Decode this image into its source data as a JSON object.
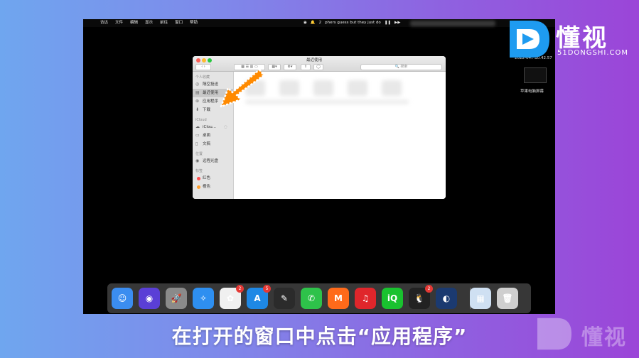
{
  "menubar": {
    "apple": "",
    "menus": [
      "访达",
      "文件",
      "编辑",
      "显示",
      "前往",
      "窗口",
      "帮助"
    ],
    "status_text": "phers guess but they just do",
    "badge_count": "2"
  },
  "desktop": {
    "date_label": "2022-04...10.42.57",
    "thumb_label": "苹果电脑屏幕"
  },
  "finder": {
    "title": "最近使用",
    "search_placeholder": "搜索",
    "sidebar": {
      "sections": {
        "personal": "个人收藏",
        "icloud": "iCloud",
        "locations": "位置",
        "tags": "标签"
      },
      "items": [
        {
          "label": "隔空投送",
          "icon": "airdrop-icon",
          "glyph": "◎"
        },
        {
          "label": "最近使用",
          "icon": "clock-icon",
          "glyph": "▤"
        },
        {
          "label": "应用程序",
          "icon": "apps-icon",
          "glyph": "⊛"
        },
        {
          "label": "下载",
          "icon": "download-icon",
          "glyph": "⬇"
        }
      ],
      "icloud_items": [
        {
          "label": "iClou...",
          "icon": "cloud-icon",
          "glyph": "☁"
        },
        {
          "label": "桌面",
          "icon": "desktop-icon",
          "glyph": "▭"
        },
        {
          "label": "文稿",
          "icon": "document-icon",
          "glyph": "▯"
        }
      ],
      "location_items": [
        {
          "label": "远程光盘",
          "icon": "disc-icon",
          "glyph": "◉"
        }
      ],
      "tag_items": [
        {
          "label": "红色",
          "color": "#ff4d4d"
        },
        {
          "label": "橙色",
          "color": "#ff9f2e"
        }
      ]
    }
  },
  "dock": {
    "apps": [
      {
        "name": "finder",
        "color": "#3b8df0",
        "glyph": "☺",
        "badge": ""
      },
      {
        "name": "siri",
        "color": "#5a3fd6",
        "glyph": "◉",
        "badge": ""
      },
      {
        "name": "launchpad",
        "color": "#8a8a8a",
        "glyph": "🚀",
        "badge": ""
      },
      {
        "name": "safari",
        "color": "#2e8ff0",
        "glyph": "✧",
        "badge": ""
      },
      {
        "name": "photos",
        "color": "#f0f0f0",
        "glyph": "✿",
        "badge": "2"
      },
      {
        "name": "app-store",
        "color": "#1e88e5",
        "glyph": "A",
        "badge": "5"
      },
      {
        "name": "script-editor",
        "color": "#2b2b2b",
        "glyph": "✎",
        "badge": ""
      },
      {
        "name": "wechat",
        "color": "#2ec24a",
        "glyph": "✆",
        "badge": ""
      },
      {
        "name": "mango-tv",
        "color": "#ff6a1a",
        "glyph": "M",
        "badge": ""
      },
      {
        "name": "netease-music",
        "color": "#e0262b",
        "glyph": "♫",
        "badge": ""
      },
      {
        "name": "iqiyi",
        "color": "#19c22f",
        "glyph": "iQ",
        "badge": ""
      },
      {
        "name": "qq",
        "color": "#222222",
        "glyph": "🐧",
        "badge": "2"
      },
      {
        "name": "quicktime",
        "color": "#1b3a70",
        "glyph": "◐",
        "badge": ""
      },
      {
        "name": "documents",
        "color": "#cfe0f2",
        "glyph": "▦",
        "badge": ""
      },
      {
        "name": "trash",
        "color": "#cfcfcf",
        "glyph": "🗑",
        "badge": ""
      }
    ]
  },
  "subtitle": "在打开的窗口中点击“应用程序”",
  "logo": {
    "name": "懂视",
    "domain": "51DONGSHI.COM"
  },
  "colors": {
    "accent_arrow": "#ff8a00",
    "screen_bg": "#000000"
  }
}
